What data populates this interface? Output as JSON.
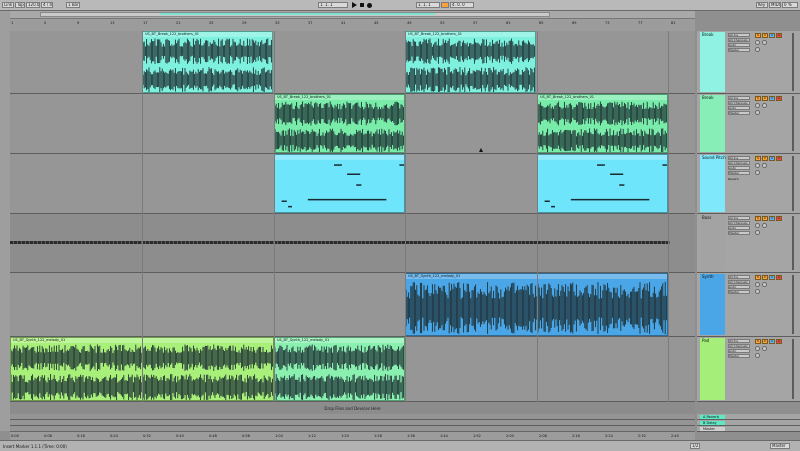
{
  "toolbar": {
    "link_label": "Link",
    "tap_label": "Tap",
    "tempo": "120.00",
    "time_signature": "4 / 4",
    "quantize": "1 Bar",
    "key_label": "Key",
    "midi_label": "MIDI",
    "cpu_label": "0 %",
    "position": "1. 1. 1",
    "loop_start": "1. 1. 1",
    "loop_length": "4. 0. 0"
  },
  "ruler": {
    "bars": [
      "1",
      "5",
      "9",
      "13",
      "17",
      "21",
      "25",
      "29",
      "33",
      "37",
      "41",
      "45",
      "49",
      "53",
      "57",
      "61",
      "65",
      "69",
      "73",
      "77",
      "81"
    ],
    "times": [
      "0:00",
      "0:08",
      "0:16",
      "0:24",
      "0:32",
      "0:40",
      "0:48",
      "0:56",
      "1:04",
      "1:12",
      "1:20",
      "1:28",
      "1:36",
      "1:44",
      "1:52",
      "2:00",
      "2:08",
      "2:16",
      "2:24",
      "2:32",
      "2:40"
    ]
  },
  "colors": {
    "break": "#7ef0de",
    "break2": "#79ecaa",
    "sound": "#6fe5fb",
    "synth": "#4aa6e6",
    "pad": "#a9f07a",
    "pad_highlight": "#8af0b0"
  },
  "tracks": [
    {
      "name": "Break",
      "color": "#8ff2e2",
      "clips": [
        {
          "title": "US_BT_Break_122_brothers_01",
          "color": "#7ef0de"
        },
        {
          "title": "US_BT_Break_122_brothers_01",
          "color": "#7ef0de"
        },
        {
          "title": "US_BT_Break_122_brothers_01",
          "color": "#7ef0de"
        },
        {
          "title": "US_BT_Break_122_brothers_01",
          "color": "#7ef0de"
        }
      ]
    },
    {
      "name": "Break",
      "color": "#86eeb6",
      "clips": [
        {
          "title": "US_BT_Break_122_brothers_01",
          "color": "#79ecaa"
        },
        {
          "title": "US_BT_Break_122_brothers_01",
          "color": "#79ecaa"
        },
        {
          "title": "US_BT_Break_122_brothers_01",
          "color": "#79ecaa"
        },
        {
          "title": "US_BT_Break_122_brothers_01",
          "color": "#79ecaa"
        }
      ]
    },
    {
      "name": "Sound Pitch",
      "color": "#7fe9fb",
      "clips": [
        {
          "title": "",
          "color": "#6fe5fb"
        },
        {
          "title": "",
          "color": "#6fe5fb"
        }
      ],
      "device": "Reverb"
    },
    {
      "name": "Bass",
      "color": "#a3a3a3",
      "clips": []
    },
    {
      "name": "Synth",
      "color": "#4aa6e6",
      "clips": [
        {
          "title": "US_BT_Synth_122_melody_01",
          "color": "#4aa6e6"
        }
      ]
    },
    {
      "name": "Pad",
      "color": "#a6ee7a",
      "clips": [
        {
          "title": "US_BT_Synth_122_melody_01",
          "color": "#a9f07a"
        },
        {
          "title": "US_BT_Synth_122_melody_01",
          "color": "#8af0b0"
        }
      ]
    }
  ],
  "returns": [
    {
      "name": "A Reverb",
      "color": "#5ee8c3"
    },
    {
      "name": "B Delay",
      "color": "#5ee8c3"
    },
    {
      "name": "Master",
      "color": "#cfcfcf"
    }
  ],
  "track_controls": {
    "input": "All Ins",
    "channel": "All Channels",
    "monitor": "Auto",
    "output": "Master",
    "volume": "0",
    "sends_label": "S",
    "solo": "S",
    "arm": "C"
  },
  "drop_area_text": "Drop Files and Devices Here",
  "status": {
    "left": "Insert Marker 1.1.1 (Time: 0:00)",
    "right": "Master",
    "zoom": "1/2"
  }
}
